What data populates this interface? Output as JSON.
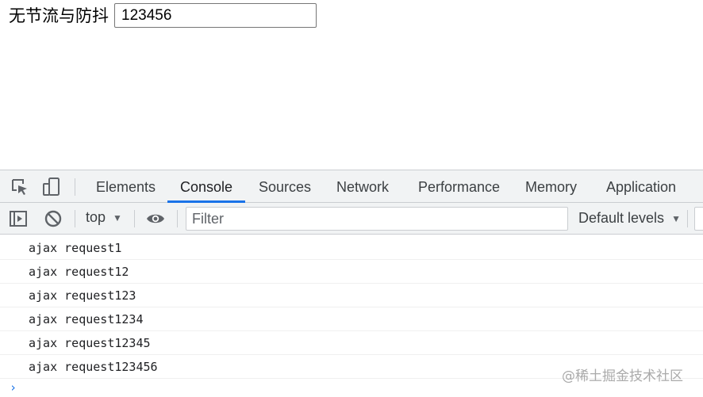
{
  "page": {
    "label": "无节流与防抖",
    "input_value": "123456"
  },
  "devtools": {
    "tabs": [
      {
        "label": "Elements"
      },
      {
        "label": "Console"
      },
      {
        "label": "Sources"
      },
      {
        "label": "Network"
      },
      {
        "label": "Performance"
      },
      {
        "label": "Memory"
      },
      {
        "label": "Application"
      }
    ],
    "active_tab": "Console",
    "toolbar": {
      "context": "top",
      "filter_placeholder": "Filter",
      "levels": "Default levels"
    },
    "console_lines": [
      "ajax request1",
      "ajax request12",
      "ajax request123",
      "ajax request1234",
      "ajax request12345",
      "ajax request123456"
    ],
    "prompt": "›"
  },
  "watermark": "@稀土掘金技术社区",
  "colors": {
    "accent": "#1a73e8",
    "toolbar_bg": "#f1f3f4"
  }
}
